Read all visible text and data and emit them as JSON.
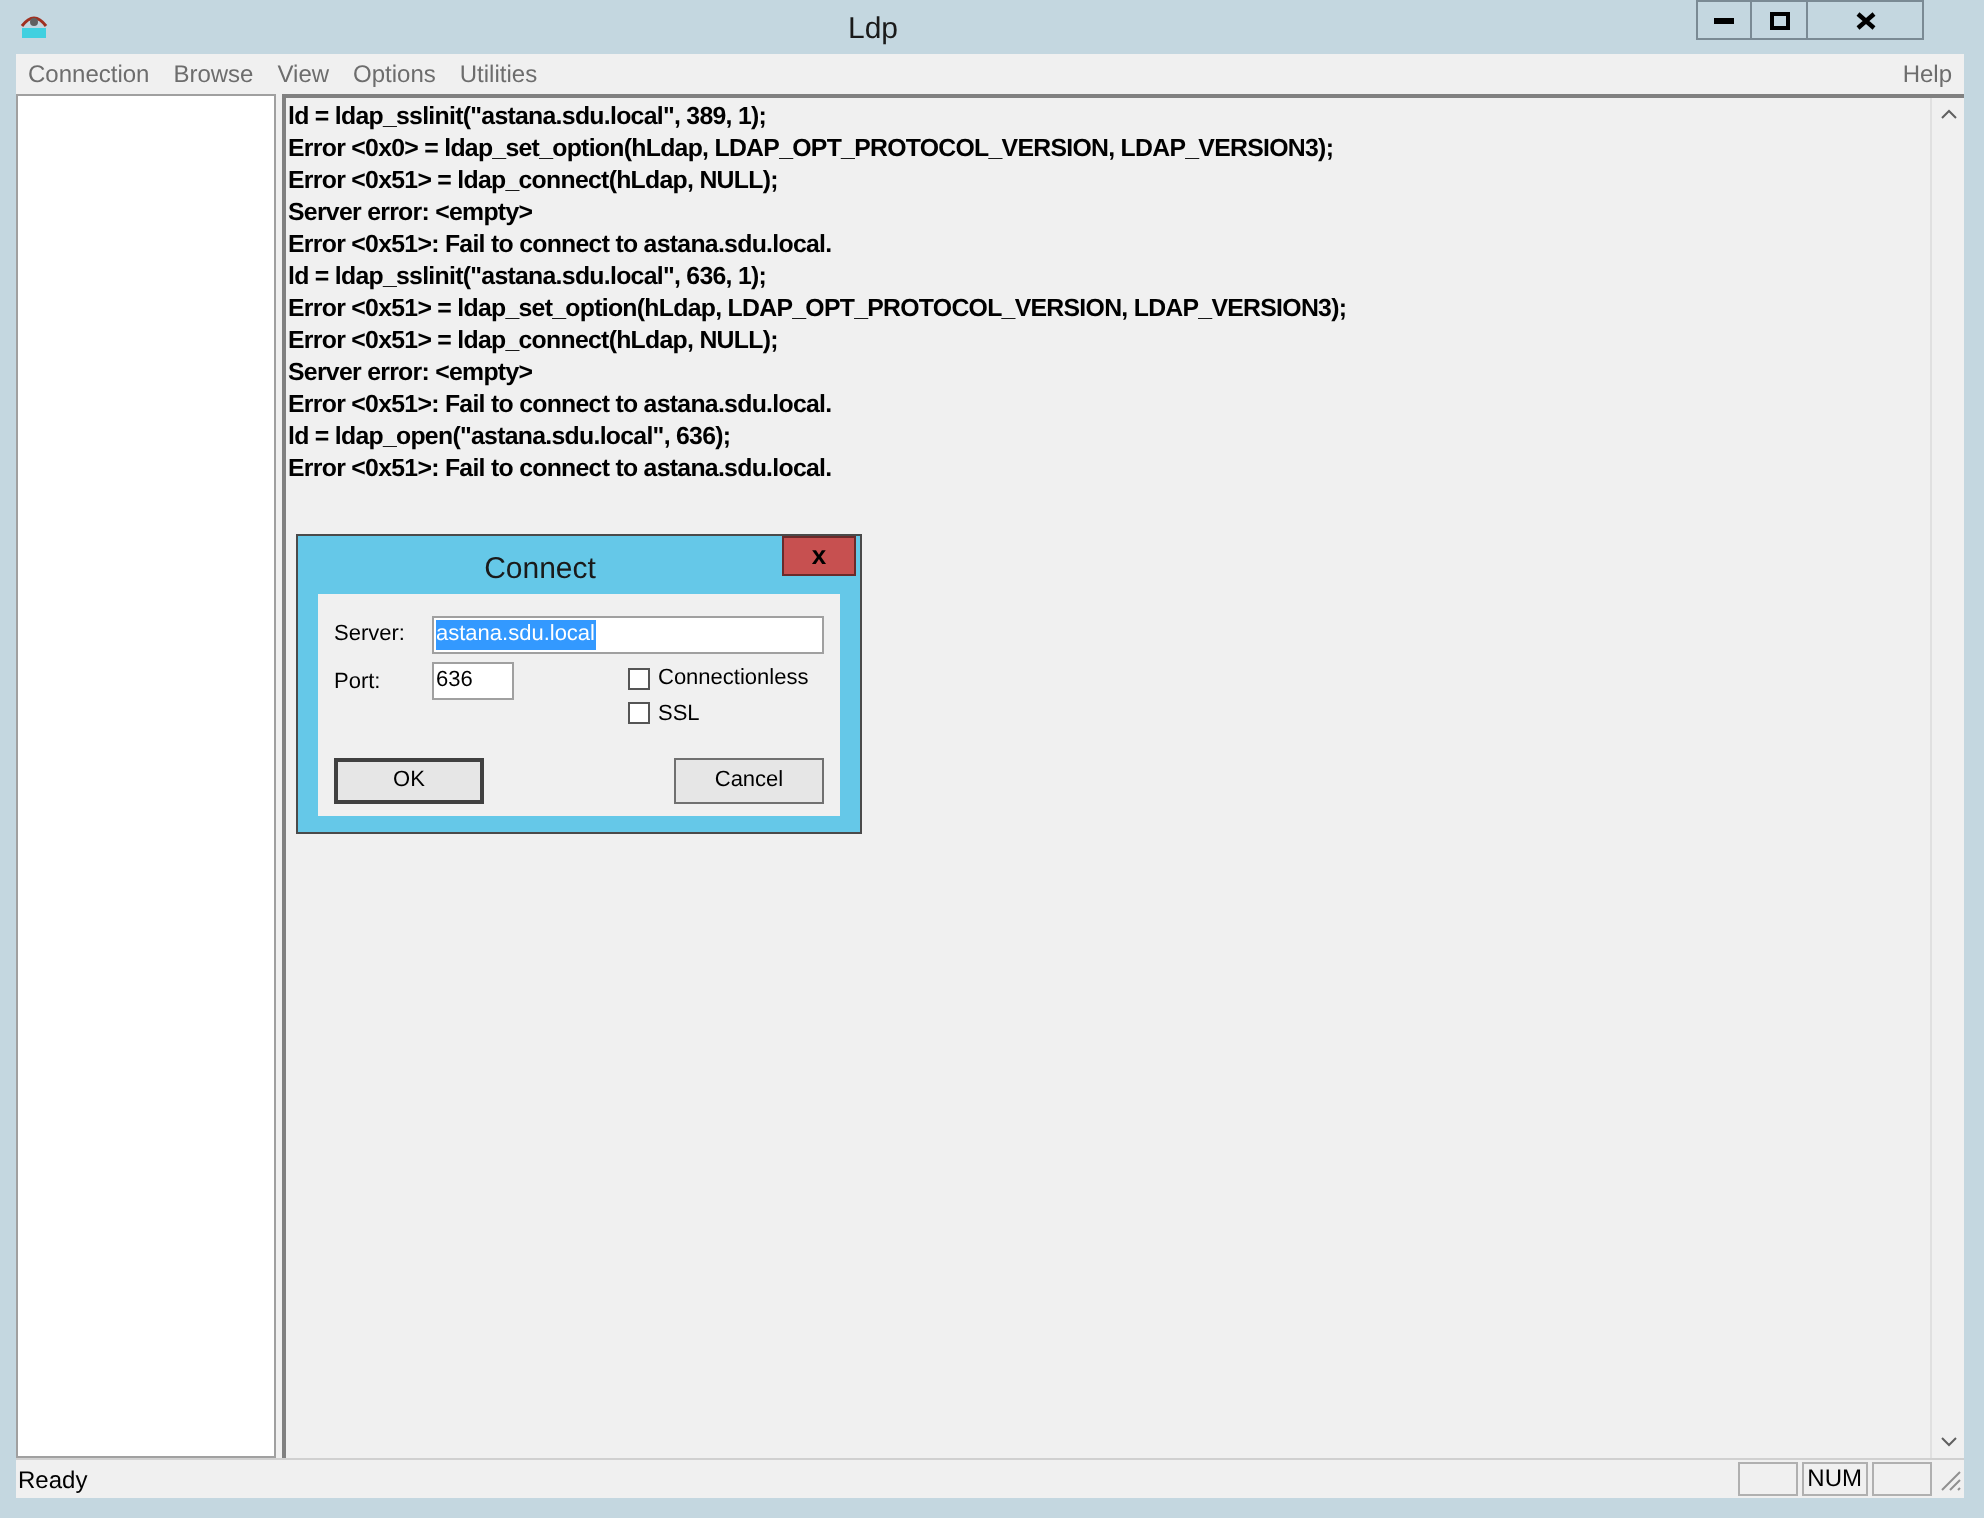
{
  "window": {
    "title": "Ldp",
    "controls": [
      {
        "kind": "minimize"
      },
      {
        "kind": "maximize"
      },
      {
        "kind": "close"
      }
    ]
  },
  "menu": [
    {
      "label": "Connection",
      "disabled": true
    },
    {
      "label": "Browse",
      "disabled": true
    },
    {
      "label": "View",
      "disabled": true
    },
    {
      "label": "Options",
      "disabled": true
    },
    {
      "label": "Utilities",
      "disabled": true
    }
  ],
  "help_menu": {
    "label": "Help",
    "disabled": true
  },
  "log": [
    "ld = ldap_sslinit(\"astana.sdu.local\", 389, 1);",
    "Error <0x0> = ldap_set_option(hLdap, LDAP_OPT_PROTOCOL_VERSION, LDAP_VERSION3);",
    "Error <0x51> = ldap_connect(hLdap, NULL);",
    "Server error: <empty>",
    "Error <0x51>: Fail to connect to astana.sdu.local.",
    "ld = ldap_sslinit(\"astana.sdu.local\", 636, 1);",
    "Error <0x51> = ldap_set_option(hLdap, LDAP_OPT_PROTOCOL_VERSION, LDAP_VERSION3);",
    "Error <0x51> = ldap_connect(hLdap, NULL);",
    "Server error: <empty>",
    "Error <0x51>: Fail to connect to astana.sdu.local.",
    "ld = ldap_open(\"astana.sdu.local\", 636);",
    "Error <0x51>: Fail to connect to astana.sdu.local."
  ],
  "dialog": {
    "title": "Connect",
    "close": "x",
    "server": {
      "label": "Server:",
      "value": "astana.sdu.local",
      "selected": true
    },
    "port": {
      "label": "Port:",
      "value": "636"
    },
    "options": [
      {
        "label": "Connectionless",
        "checked": false
      },
      {
        "label": "SSL",
        "checked": false
      }
    ],
    "buttons": [
      {
        "label": "OK",
        "default": true
      },
      {
        "label": "Cancel",
        "default": false
      }
    ]
  },
  "status_bar": {
    "text": "Ready",
    "indicators": [
      {
        "kind": "blank"
      },
      {
        "kind": "text",
        "text": "NUM"
      },
      {
        "kind": "blank"
      }
    ]
  }
}
